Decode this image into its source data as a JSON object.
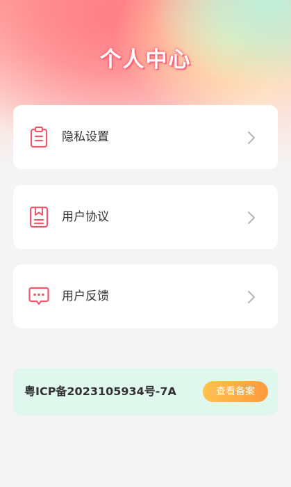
{
  "header": {
    "title": "个人中心"
  },
  "menu": {
    "items": [
      {
        "label": "隐私设置",
        "icon": "clipboard-icon"
      },
      {
        "label": "用户协议",
        "icon": "document-icon"
      },
      {
        "label": "用户反馈",
        "icon": "message-icon"
      }
    ]
  },
  "icp": {
    "text": "粤ICP备2023105934号-7A",
    "button_label": "查看备案"
  },
  "colors": {
    "accent": "#f0566c",
    "icp_background": "#dff7ec",
    "button_start": "#ffc24a",
    "button_end": "#ff9a3e"
  }
}
